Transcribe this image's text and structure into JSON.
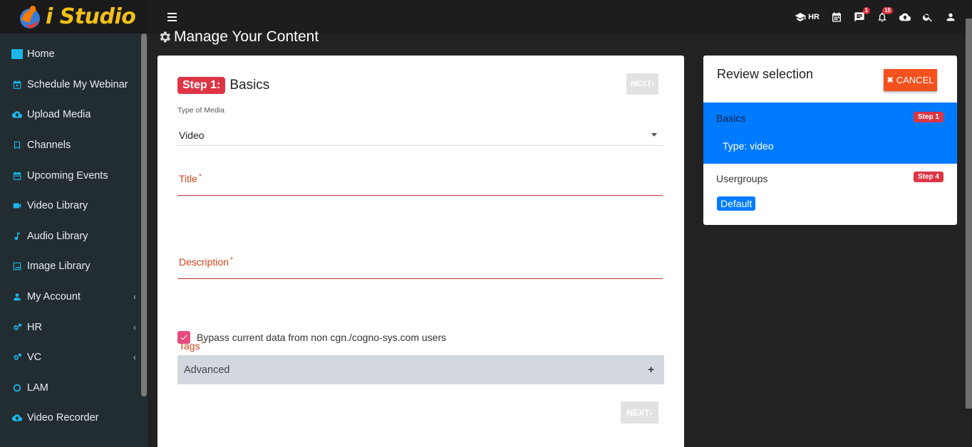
{
  "brand": {
    "name": "i Studio"
  },
  "sidebar": {
    "items": [
      {
        "label": "Home",
        "icon": "home-icon",
        "has_submenu": false
      },
      {
        "label": "Schedule My Webinar",
        "icon": "calendar-plus-icon",
        "has_submenu": false
      },
      {
        "label": "Upload Media",
        "icon": "cloud-upload-icon",
        "has_submenu": false
      },
      {
        "label": "Channels",
        "icon": "bookmark-icon",
        "has_submenu": false
      },
      {
        "label": "Upcoming Events",
        "icon": "calendar-icon",
        "has_submenu": false
      },
      {
        "label": "Video Library",
        "icon": "video-icon",
        "has_submenu": false
      },
      {
        "label": "Audio Library",
        "icon": "music-icon",
        "has_submenu": false
      },
      {
        "label": "Image Library",
        "icon": "image-icon",
        "has_submenu": false
      },
      {
        "label": "My Account",
        "icon": "user-icon",
        "has_submenu": true
      },
      {
        "label": "HR",
        "icon": "cogs-icon",
        "has_submenu": true
      },
      {
        "label": "VC",
        "icon": "cogs-icon",
        "has_submenu": true
      },
      {
        "label": "LAM",
        "icon": "circle-icon",
        "has_submenu": false
      },
      {
        "label": "Video Recorder",
        "icon": "cloud-upload-icon",
        "has_submenu": false
      }
    ],
    "chevron": "‹"
  },
  "topbar": {
    "hr_label": "HR",
    "messages_count": "1",
    "notifications_count": "15"
  },
  "page": {
    "title": "Manage Your Content"
  },
  "form": {
    "step_tag": "Step 1:",
    "step_title": "Basics",
    "next_label": "NEXT",
    "next_chevron": "›",
    "media_type_label": "Type of Media",
    "media_type_value": "Video",
    "title_label": "Title",
    "description_label": "Description",
    "tags_label": "Tags",
    "required_mark": "*",
    "bypass_label": "Bypass current data from non cgn./cogno-sys.com users",
    "bypass_checked": true,
    "advanced_label": "Advanced",
    "advanced_toggle": "+"
  },
  "review": {
    "title": "Review selection",
    "cancel_label": "CANCEL",
    "cancel_icon": "✖",
    "basics_label": "Basics",
    "basics_step": "Step 1",
    "basics_value": "Type: video",
    "usergroups_label": "Usergroups",
    "usergroups_step": "Step 4",
    "usergroups_value": "Default"
  },
  "colors": {
    "accent_blue": "#007bff",
    "step_red": "#dd3545",
    "cancel_orange": "#f4511e",
    "required_red": "#d0421b",
    "checkbox_pink": "#e64c7f",
    "logo_yellow": "#f2c018"
  }
}
